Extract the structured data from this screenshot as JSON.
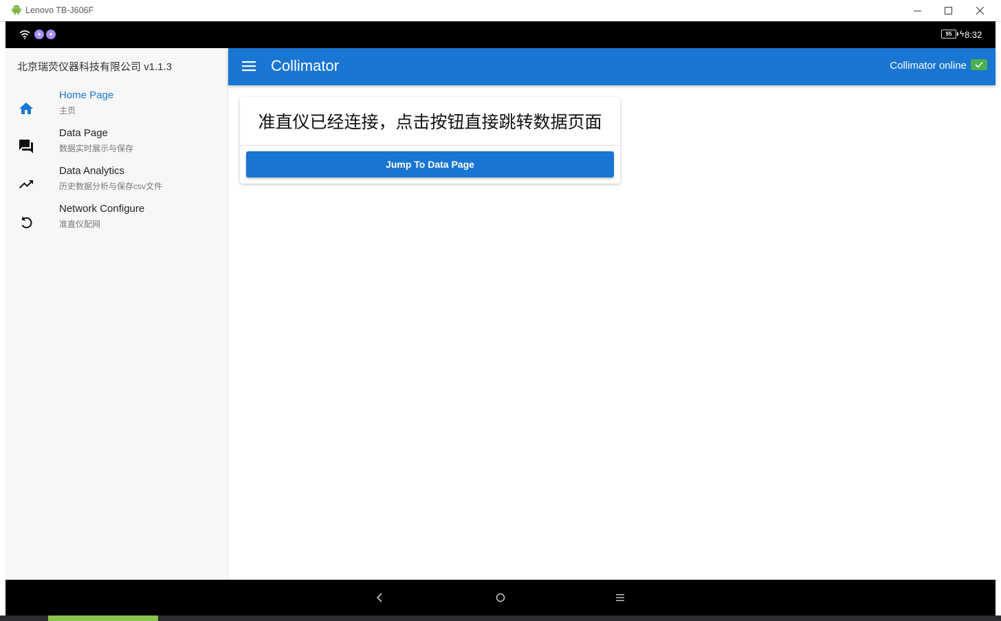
{
  "window": {
    "title": "Lenovo TB-J606F",
    "controls": [
      "minimize-icon",
      "maximize-icon",
      "close-icon"
    ]
  },
  "statusbar": {
    "battery": "95",
    "time": "8:32"
  },
  "drawer": {
    "header": "北京瑞荧仪器科技有限公司 v1.1.3",
    "items": [
      {
        "label": "Home Page",
        "sub": "主页",
        "icon": "home-icon",
        "active": true
      },
      {
        "label": "Data Page",
        "sub": "数据实时展示与保存",
        "icon": "chat-icon",
        "active": false
      },
      {
        "label": "Data Analytics",
        "sub": "历史数据分析与保存csv文件",
        "icon": "trending-up-icon",
        "active": false
      },
      {
        "label": "Network Configure",
        "sub": "准直仪配网",
        "icon": "refresh-icon",
        "active": false
      }
    ]
  },
  "appbar": {
    "title": "Collimator",
    "status": "Collimator online",
    "status_color": "#4caf50",
    "color": "#1976d2"
  },
  "card": {
    "message": "准直仪已经连接，点击按钮直接跳转数据页面",
    "button_label": "Jump To Data Page"
  },
  "navbar": {
    "buttons": [
      "back-icon",
      "home-circle-icon",
      "recents-icon"
    ]
  }
}
